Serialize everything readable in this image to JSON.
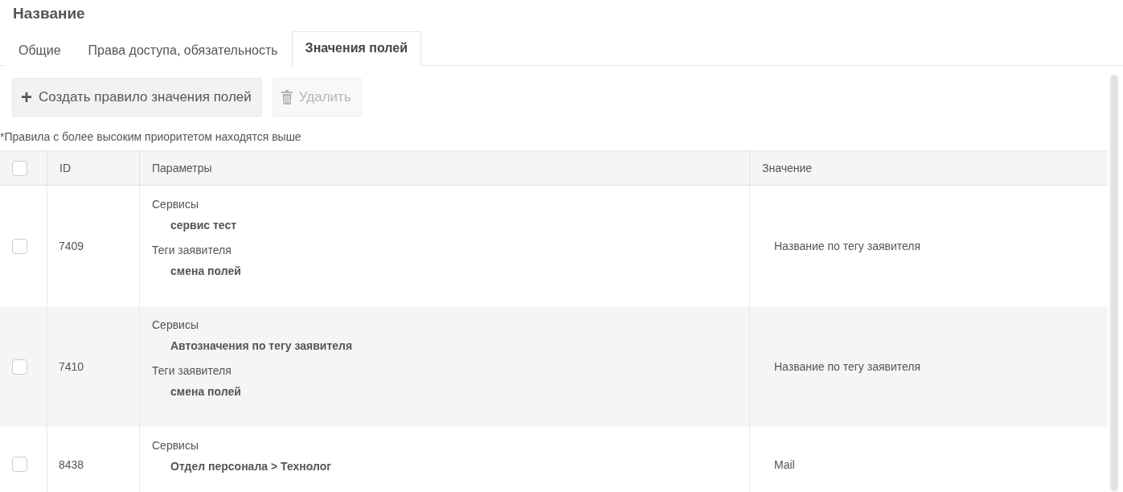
{
  "title": "Название",
  "tabs": [
    {
      "label": "Общие",
      "selected": false
    },
    {
      "label": "Права доступа, обязательность",
      "selected": false
    },
    {
      "label": "Значения полей",
      "selected": true
    }
  ],
  "toolbar": [
    {
      "kind": "add",
      "icon": "+",
      "label": "Создать правило значения полей",
      "disabled": false
    },
    {
      "kind": "delete",
      "label": "Удалить",
      "disabled": true
    }
  ],
  "note": "*Правила с более высоким приоритетом находятся выше",
  "table": {
    "select_all_checked": false,
    "columns": [
      "ID",
      "Параметры",
      "Значение"
    ],
    "rows": [
      {
        "checked": false,
        "id": "7409",
        "params": [
          {
            "label": "Сервисы",
            "values": [
              "сервис тест"
            ]
          },
          {
            "label": "Теги заявителя",
            "values": [
              "смена полей"
            ]
          }
        ],
        "value": "Название по тегу заявителя"
      },
      {
        "checked": false,
        "id": "7410",
        "params": [
          {
            "label": "Сервисы",
            "values": [
              "Автозначения по тегу заявителя"
            ]
          },
          {
            "label": "Теги заявителя",
            "values": [
              "смена полей"
            ]
          }
        ],
        "value": "Название по тегу заявителя"
      },
      {
        "checked": false,
        "id": "8438",
        "params": [
          {
            "label": "Сервисы",
            "values": [
              "Отдел персонала > Технолог"
            ]
          }
        ],
        "value": "Mail"
      }
    ]
  }
}
